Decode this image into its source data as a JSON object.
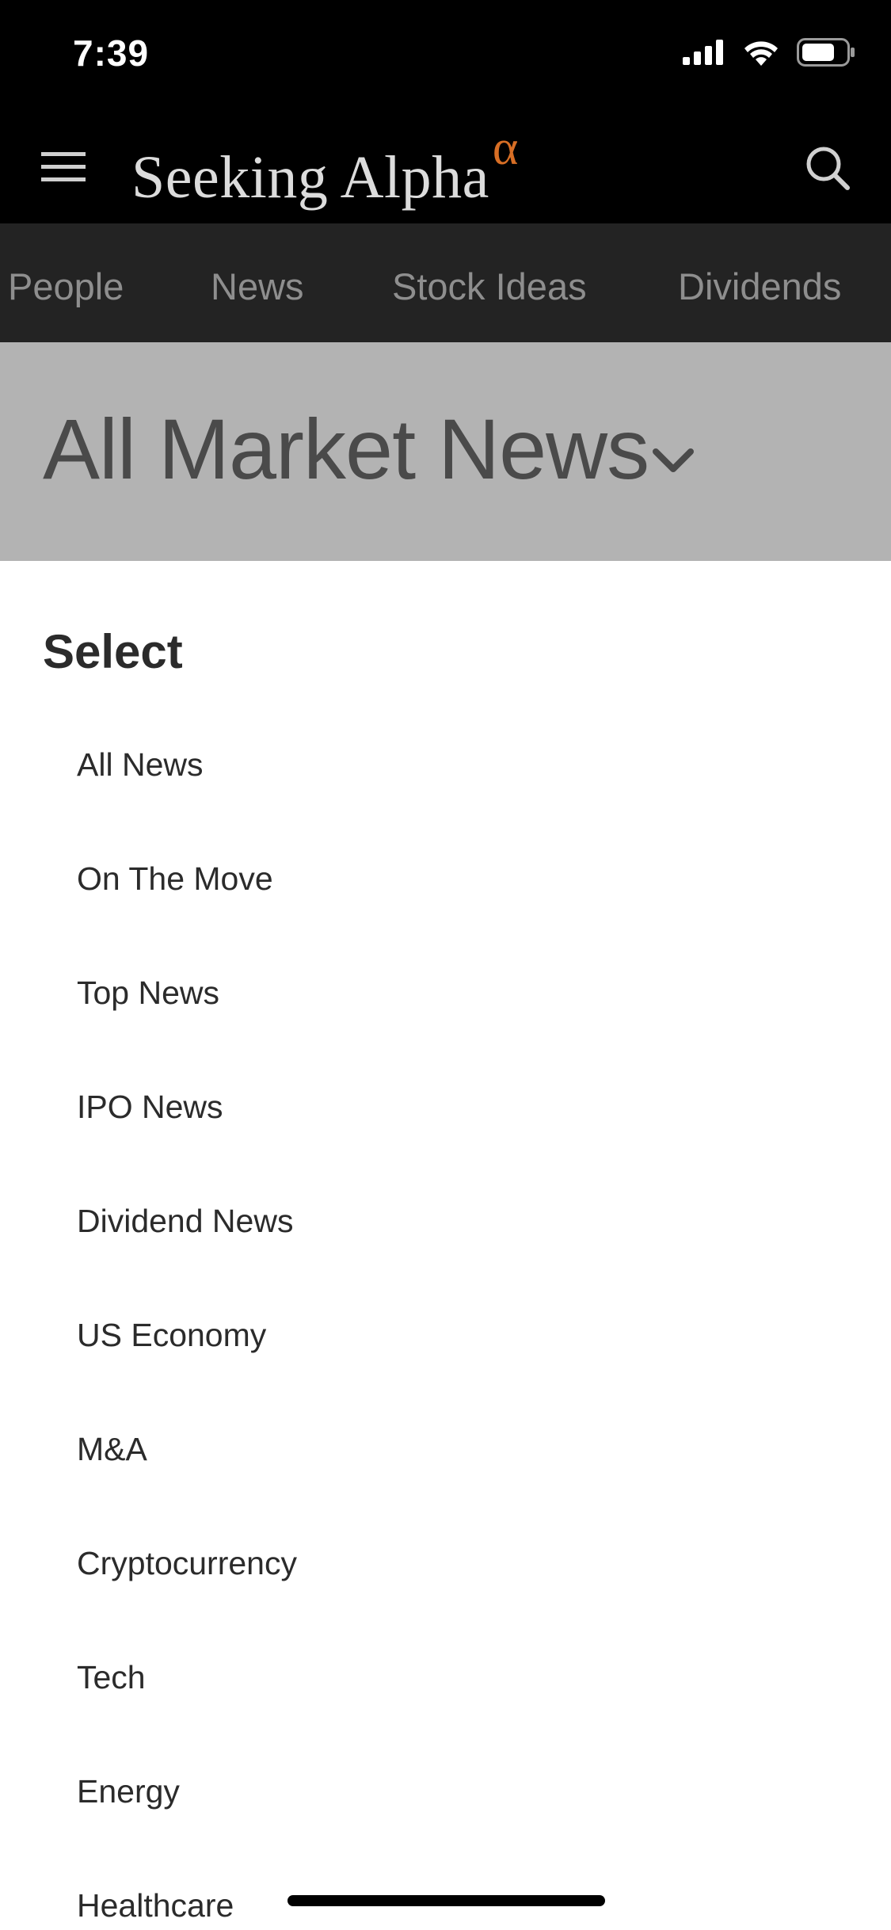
{
  "status_bar": {
    "time": "7:39"
  },
  "header": {
    "menu_icon": "hamburger-menu-icon",
    "brand_name": "Seeking Alpha",
    "brand_mark": "α",
    "brand_mark_color": "#d76e25",
    "search_icon": "search-icon"
  },
  "nav": {
    "tabs": [
      {
        "label": "People"
      },
      {
        "label": "News"
      },
      {
        "label": "Stock Ideas"
      },
      {
        "label": "Dividends"
      }
    ]
  },
  "page": {
    "title": "All Market News",
    "title_icon": "chevron-down-icon"
  },
  "sheet": {
    "title": "Select",
    "options": [
      {
        "label": "All News"
      },
      {
        "label": "On The Move"
      },
      {
        "label": "Top News"
      },
      {
        "label": "IPO News"
      },
      {
        "label": "Dividend News"
      },
      {
        "label": "US Economy"
      },
      {
        "label": "M&A"
      },
      {
        "label": "Cryptocurrency"
      },
      {
        "label": "Tech"
      },
      {
        "label": "Energy"
      },
      {
        "label": "Healthcare"
      }
    ]
  }
}
